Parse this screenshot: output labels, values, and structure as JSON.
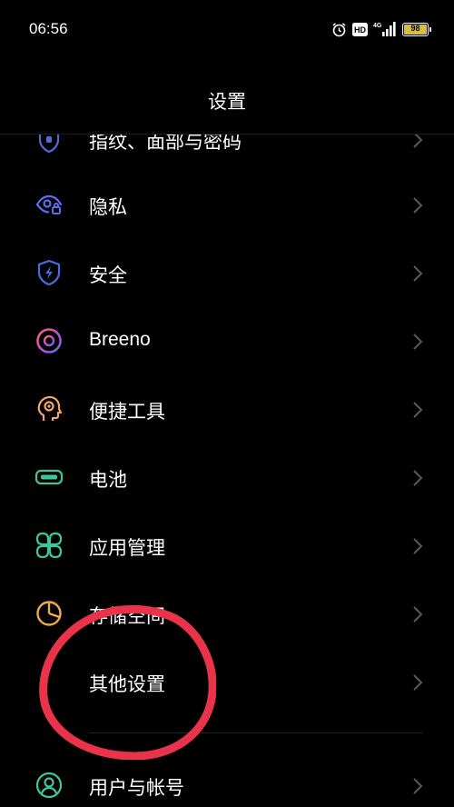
{
  "status_bar": {
    "time": "06:56",
    "battery_level": "98",
    "network": "4G",
    "hd_label": "HD"
  },
  "header": {
    "title": "设置"
  },
  "settings": {
    "items": [
      {
        "label": "指纹、面部与密码",
        "icon": "fingerprint-lock-icon",
        "color": "#4f6bd8"
      },
      {
        "label": "隐私",
        "icon": "privacy-eye-icon",
        "color": "#5b6ef0"
      },
      {
        "label": "安全",
        "icon": "shield-icon",
        "color": "#4a6de5"
      },
      {
        "label": "Breeno",
        "icon": "breeno-icon",
        "color": "#c04dd0"
      },
      {
        "label": "便捷工具",
        "icon": "convenience-tools-icon",
        "color": "#f0a56a"
      },
      {
        "label": "电池",
        "icon": "battery-icon",
        "color": "#3fc49c"
      },
      {
        "label": "应用管理",
        "icon": "app-grid-icon",
        "color": "#3fc49c"
      },
      {
        "label": "存储空间",
        "icon": "storage-pie-icon",
        "color": "#f2a84f"
      },
      {
        "label": "其他设置",
        "icon": "",
        "color": ""
      },
      {
        "label": "用户与帐号",
        "icon": "user-account-icon",
        "color": "#3fc49c"
      }
    ]
  },
  "annotation": {
    "color": "#e8334a"
  }
}
